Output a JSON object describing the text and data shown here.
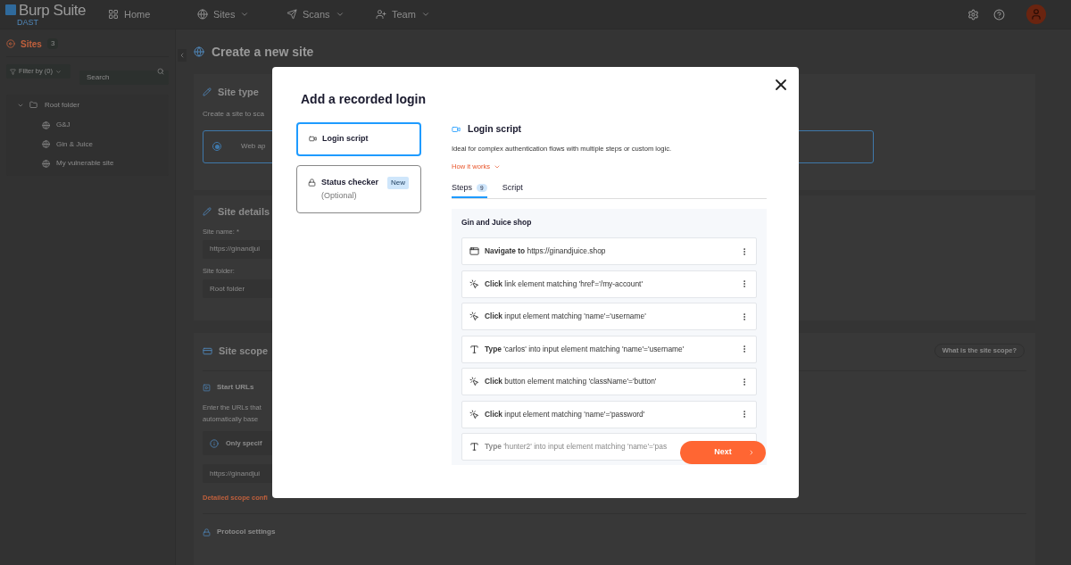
{
  "app": {
    "logo": "Burp Suite",
    "product": "DAST"
  },
  "nav": [
    {
      "label": "Home",
      "dropdown": false
    },
    {
      "label": "Sites",
      "dropdown": true
    },
    {
      "label": "Scans",
      "dropdown": true
    },
    {
      "label": "Team",
      "dropdown": true
    }
  ],
  "sidebar": {
    "title": "Sites",
    "count": "3",
    "filter": "Filter by (0)",
    "search": {
      "placeholder": "Search"
    },
    "tree": [
      {
        "label": "Root folder",
        "expanded": true,
        "children": [
          {
            "label": "G&J"
          },
          {
            "label": "Gin & Juice"
          },
          {
            "label": "My vulnerable site"
          }
        ]
      }
    ]
  },
  "page": {
    "title": "Create a new site",
    "site_type": {
      "title": "Site type",
      "description": "Create a site to sca",
      "option": {
        "label": "Web ap",
        "selected": true
      }
    },
    "site_details": {
      "title": "Site details",
      "fields": [
        {
          "label": "Site name: *",
          "value": "https://ginandjui"
        },
        {
          "label": "Site folder:",
          "value": "Root folder"
        }
      ]
    },
    "site_scope": {
      "title": "Site scope",
      "help_button": "What is the site scope?",
      "start_urls": {
        "title": "Start URLs",
        "description_lines": [
          "Enter the URLs that",
          "automatically base"
        ],
        "notice": "Only specif",
        "url_value": "https://ginandjui",
        "scope_link": "Detailed scope confi"
      },
      "protocol_settings": "Protocol settings"
    }
  },
  "modal": {
    "title": "Add a recorded login",
    "options": [
      {
        "kind": "script",
        "label": "Login script",
        "selected": true
      },
      {
        "kind": "checker",
        "label": "Status checker",
        "sub": "(Optional)",
        "badge": "New",
        "selected": false
      }
    ],
    "detail": {
      "title": "Login script",
      "description": "Ideal for complex authentication flows with multiple steps or custom logic.",
      "how_link": "How it works",
      "tabs": [
        {
          "label": "Steps",
          "count": "9",
          "selected": true
        },
        {
          "label": "Script",
          "selected": false
        }
      ],
      "group": {
        "title": "Gin and Juice shop",
        "steps": [
          {
            "kind": "navigate",
            "text": "**Navigate to** https://ginandjuice.shop"
          },
          {
            "kind": "click",
            "text": "**Click** link element matching 'href'='/my-account'"
          },
          {
            "kind": "click",
            "text": "**Click** input element matching 'name'='username'"
          },
          {
            "kind": "type",
            "text": "**Type** 'carlos' into input element matching 'name'='username'"
          },
          {
            "kind": "click",
            "text": "**Click** button element matching 'className'='button'"
          },
          {
            "kind": "click",
            "text": "**Click** input element matching 'name'='password'"
          },
          {
            "kind": "type",
            "text": "**Type** 'hunter2' into input element matching 'name'='pas"
          }
        ]
      }
    },
    "next_button": "Next"
  }
}
